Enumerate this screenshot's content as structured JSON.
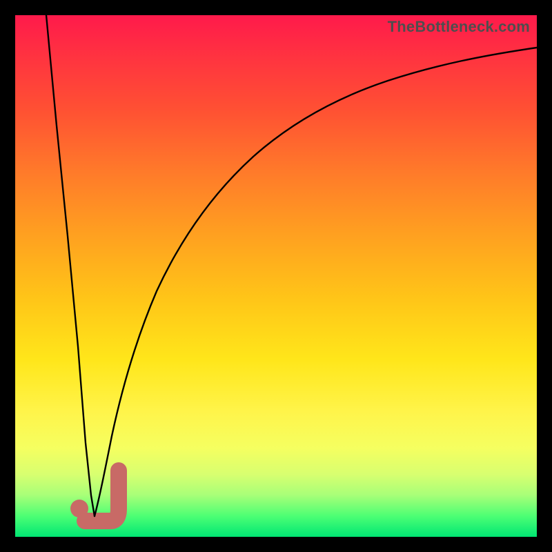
{
  "attribution": "TheBottleneck.com",
  "colors": {
    "frame": "#000000",
    "gradient_top": "#ff1a4b",
    "gradient_bottom": "#00e673",
    "curve": "#000000",
    "marker": "#c86a66"
  },
  "chart_data": {
    "type": "line",
    "title": "",
    "xlabel": "",
    "ylabel": "",
    "xlim": [
      0,
      100
    ],
    "ylim": [
      0,
      100
    ],
    "series": [
      {
        "name": "left-branch",
        "x": [
          6,
          8,
          10,
          12,
          13.5,
          14.5,
          15.2
        ],
        "values": [
          100,
          79,
          58,
          36,
          18,
          8,
          4
        ]
      },
      {
        "name": "right-branch",
        "x": [
          15.2,
          16,
          18,
          20,
          23,
          27,
          32,
          38,
          45,
          53,
          62,
          72,
          83,
          92,
          100
        ],
        "values": [
          4,
          6,
          18,
          30,
          44,
          56,
          66,
          74,
          80,
          84,
          87.5,
          90,
          92,
          93,
          93.8
        ]
      }
    ],
    "annotations": [
      {
        "name": "J-marker",
        "shape": "J",
        "x": 16.5,
        "y": 5,
        "color": "#c86a66"
      }
    ]
  }
}
